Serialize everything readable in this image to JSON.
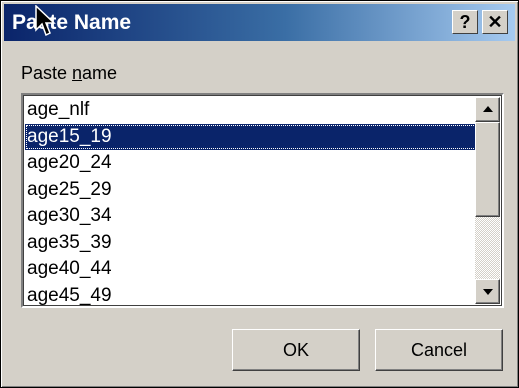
{
  "window": {
    "title": "Paste Name",
    "help_label": "?",
    "close_label": "✕"
  },
  "field": {
    "label_pre": "Paste ",
    "label_mnemonic": "n",
    "label_post": "ame"
  },
  "list": {
    "items": [
      "age_nlf",
      "age15_19",
      "age20_24",
      "age25_29",
      "age30_34",
      "age35_39",
      "age40_44",
      "age45_49"
    ],
    "selected": "age15_19"
  },
  "buttons": {
    "ok": "OK",
    "cancel": "Cancel"
  },
  "colors": {
    "titlebar_start": "#0a246a",
    "titlebar_end": "#a6caf0",
    "selection": "#0a246a",
    "face": "#d4d0c8"
  }
}
